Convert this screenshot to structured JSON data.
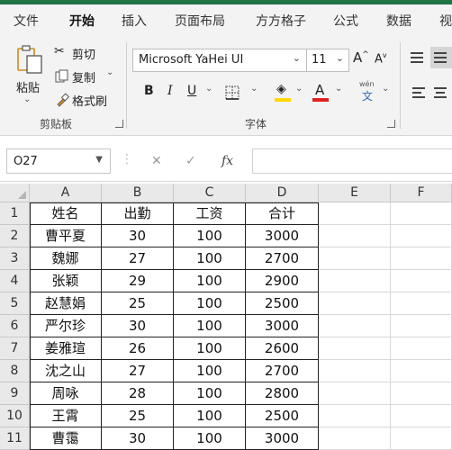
{
  "tabs": [
    "文件",
    "开始",
    "插入",
    "页面布局",
    "方方格子",
    "公式",
    "数据",
    "视"
  ],
  "active_tab": "开始",
  "clipboard": {
    "paste_label": "粘贴",
    "cut_label": "剪切",
    "copy_label": "复制",
    "format_painter_label": "格式刷",
    "group_label": "剪贴板"
  },
  "font": {
    "name": "Microsoft YaHei UI",
    "size": "11",
    "grow_label": "A",
    "shrink_label": "A",
    "bold_label": "B",
    "italic_label": "I",
    "underline_label": "U",
    "font_color_label": "A",
    "phonetic_label": "wén",
    "phonetic_sub": "文",
    "group_label": "字体"
  },
  "formula_bar": {
    "name_box": "O27",
    "fx_label": "fx",
    "formula_value": ""
  },
  "colors": {
    "accent": "#217346",
    "fill_yellow": "#ffd800",
    "font_red": "#e02020"
  },
  "sheet": {
    "columns": [
      "A",
      "B",
      "C",
      "D",
      "E",
      "F"
    ],
    "rows": [
      "1",
      "2",
      "3",
      "4",
      "5",
      "6",
      "7",
      "8",
      "9",
      "10",
      "11"
    ],
    "cells": [
      [
        "姓名",
        "出勤",
        "工资",
        "合计"
      ],
      [
        "曹平夏",
        "30",
        "100",
        "3000"
      ],
      [
        "魏娜",
        "27",
        "100",
        "2700"
      ],
      [
        "张颖",
        "29",
        "100",
        "2900"
      ],
      [
        "赵慧娟",
        "25",
        "100",
        "2500"
      ],
      [
        "严尔珍",
        "30",
        "100",
        "3000"
      ],
      [
        "姜雅瑄",
        "26",
        "100",
        "2600"
      ],
      [
        "沈之山",
        "27",
        "100",
        "2700"
      ],
      [
        "周咏",
        "28",
        "100",
        "2800"
      ],
      [
        "王霄",
        "25",
        "100",
        "2500"
      ],
      [
        "曹霭",
        "30",
        "100",
        "3000"
      ]
    ]
  }
}
